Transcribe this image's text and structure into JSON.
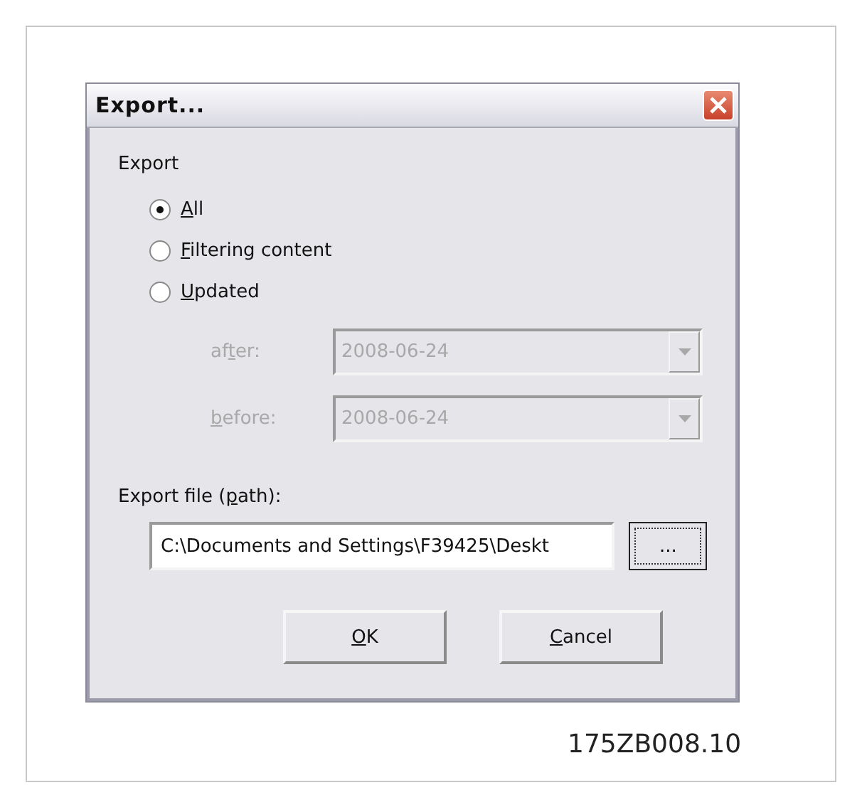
{
  "window": {
    "title": "Export..."
  },
  "group_label": "Export",
  "options": [
    {
      "key": "A",
      "post": "ll",
      "selected": true
    },
    {
      "key": "F",
      "post": "iltering content",
      "selected": false
    },
    {
      "key": "U",
      "post": "pdated",
      "selected": false
    }
  ],
  "date_filters": [
    {
      "pre": "af",
      "key": "t",
      "post": "er:",
      "value": "2008-06-24",
      "disabled": true
    },
    {
      "key": "b",
      "post": "efore:",
      "value": "2008-06-24",
      "disabled": true
    }
  ],
  "path_label": {
    "pre": "Export file (",
    "key": "p",
    "post": "ath):"
  },
  "path_value": "C:\\Documents and Settings\\F39425\\Deskt",
  "browse_button": "...",
  "buttons": [
    {
      "key": "O",
      "post": "K"
    },
    {
      "key": "C",
      "post": "ancel"
    }
  ],
  "figure_code": "175ZB008.10"
}
